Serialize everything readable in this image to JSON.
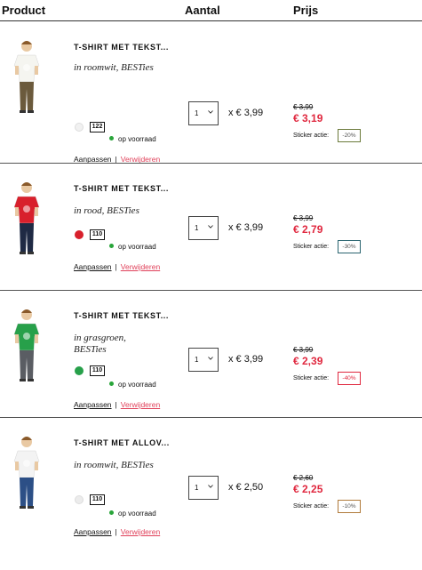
{
  "header": {
    "product": "Product",
    "quantity": "Aantal",
    "price": "Prijs"
  },
  "labels": {
    "adjust": "Aanpassen",
    "separator": "|",
    "remove": "Verwijderen",
    "stock": "op voorraad",
    "sticker": "Sticker actie:",
    "chevron_icon": "chevron-down-icon"
  },
  "items": [
    {
      "name": "T-SHIRT MET TEKST...",
      "variant": "in roomwit, BESTies",
      "swatch_color": "#f1f1f1",
      "size": "122",
      "quantity": "1",
      "unit_price": "x € 3,99",
      "old_price": "€ 3,99",
      "new_price": "€ 3,19",
      "discount": "-20%",
      "badge_color": "#6b7a3a",
      "shirt_color": "#f5f5f0",
      "pants_color": "#6b5a3c"
    },
    {
      "name": "T-SHIRT MET TEKST...",
      "variant": "in rood, BESTies",
      "swatch_color": "#d8202c",
      "size": "110",
      "quantity": "1",
      "unit_price": "x € 3,99",
      "old_price": "€ 3,99",
      "new_price": "€ 2,79",
      "discount": "-30%",
      "badge_color": "#2a6470",
      "shirt_color": "#d8202c",
      "pants_color": "#1f2a44"
    },
    {
      "name": "T-SHIRT MET TEKST...",
      "variant": "in grasgroen, BESTies",
      "swatch_color": "#27a04a",
      "size": "110",
      "quantity": "1",
      "unit_price": "x € 3,99",
      "old_price": "€ 3,99",
      "new_price": "€ 2,39",
      "discount": "-40%",
      "badge_color": "#e0283f",
      "shirt_color": "#27a04a",
      "pants_color": "#5a5d63"
    },
    {
      "name": "T-SHIRT MET ALLOV...",
      "variant": "in roomwit, BESTies",
      "swatch_color": "#ececec",
      "size": "110",
      "quantity": "1",
      "unit_price": "x € 2,50",
      "old_price": "€ 2,60",
      "new_price": "€ 2,25",
      "discount": "-10%",
      "badge_color": "#b07a3a",
      "shirt_color": "#f3f3f3",
      "pants_color": "#2c4f86"
    }
  ]
}
